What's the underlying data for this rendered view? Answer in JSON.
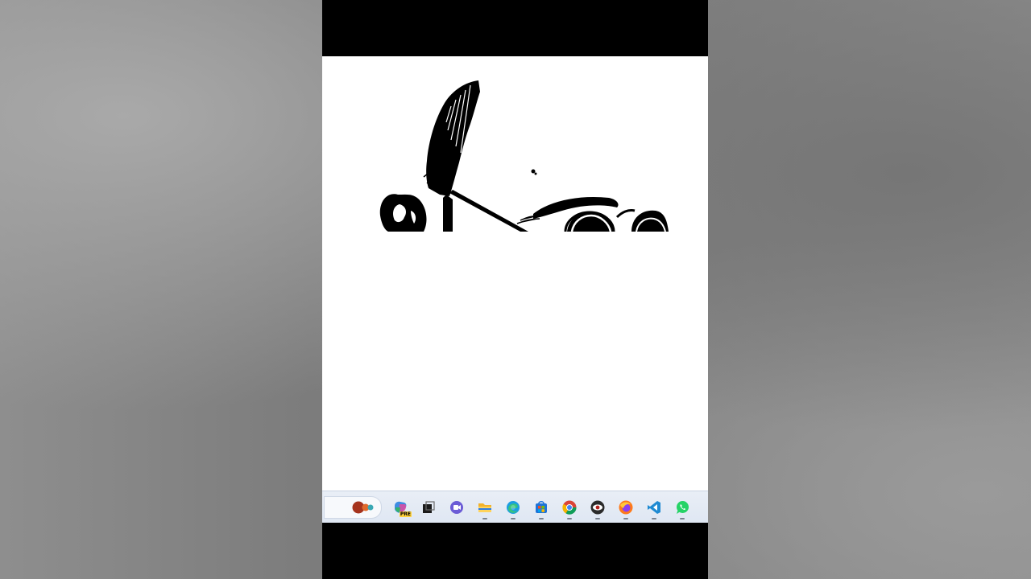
{
  "taskbar": {
    "apps": [
      {
        "name": "copilot-pre",
        "badge": "PRE",
        "running": false
      },
      {
        "name": "task-view",
        "running": false
      },
      {
        "name": "teams-chat",
        "running": false
      },
      {
        "name": "file-explorer",
        "running": true
      },
      {
        "name": "edge",
        "running": true
      },
      {
        "name": "microsoft-store",
        "running": true
      },
      {
        "name": "chrome",
        "running": true
      },
      {
        "name": "eye-app",
        "running": true
      },
      {
        "name": "firefox",
        "running": true
      },
      {
        "name": "vscode",
        "running": true
      },
      {
        "name": "whatsapp",
        "running": true
      }
    ]
  },
  "colors": {
    "side_background": "#8a8a8a",
    "letterbox": "#000000",
    "canvas": "#ffffff",
    "taskbar": "#e4ebf5"
  }
}
